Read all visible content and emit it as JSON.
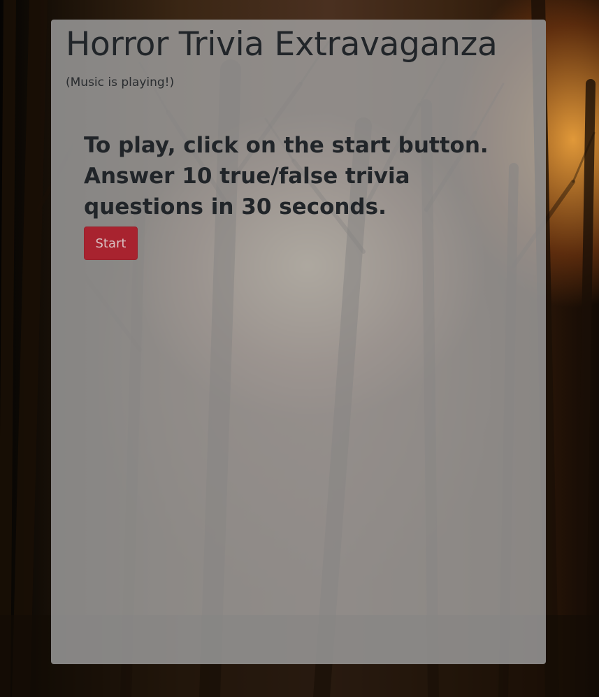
{
  "page": {
    "title": "Horror Trivia Extravaganza",
    "music_note": "(Music is playing!)",
    "instructions": "To play, click on the start button. Answer 10 true/false trivia questions in 30 seconds.",
    "start_label": "Start"
  },
  "colors": {
    "start_button": "#a8232f",
    "card_background": "#a0a0a0",
    "text": "#212529"
  },
  "icons": {
    "background": "forest-background"
  }
}
